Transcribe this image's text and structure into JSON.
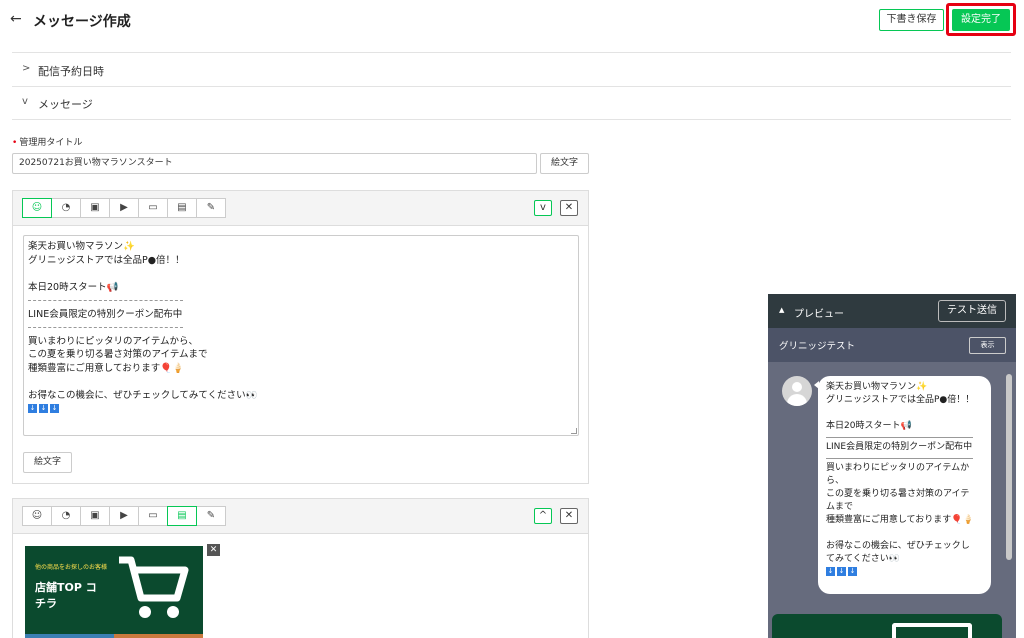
{
  "header": {
    "back_icon": "←",
    "title": "メッセージ作成",
    "draft_button": "下書き保存",
    "done_button": "設定完了",
    "accent_color": "#06c755",
    "highlight_color": "#e60012"
  },
  "sections": {
    "schedule": {
      "chevron": ">",
      "label": "配信予約日時"
    },
    "message": {
      "chevron": "v",
      "label": "メッセージ"
    }
  },
  "admin_title": {
    "label": "管理用タイトル",
    "required_mark": "•",
    "value": "20250721お買い物マラソンスタート",
    "emoji_button": "絵文字"
  },
  "message_1": {
    "toolbar": [
      "text-bubble-icon",
      "sticker-icon",
      "image-icon",
      "video-icon",
      "folder-icon",
      "list-icon",
      "pencil-icon"
    ],
    "toolbar_glyphs": [
      "☺",
      "◔",
      "▣",
      "▶",
      "▭",
      "▤",
      "✎"
    ],
    "move_down": "v",
    "close": "✕",
    "lines": [
      "楽天お買い物マラソン✨",
      "グリニッジストアでは全品P●倍！！",
      "",
      "本日20時スタート📢",
      "---",
      "LINE会員限定の特別クーポン配布中",
      "---",
      "買いまわりにピッタリのアイテムから、",
      "この夏を乗り切る暑さ対策のアイテムまで",
      "種類豊富にご用意しております🎈🍦",
      "",
      "お得なこの機会に、ぜひチェックしてみてください👀",
      "⬇⬇⬇"
    ],
    "emoji_button": "絵文字"
  },
  "message_2": {
    "toolbar_glyphs": [
      "☺",
      "◔",
      "▣",
      "▶",
      "▭",
      "▤",
      "✎"
    ],
    "move_up": "^",
    "close": "✕",
    "banner_small": "他の商品をお探しのお客様",
    "banner_big": "店舗TOP コチラ",
    "banner_close": "✕"
  },
  "preview": {
    "toggle": "▲",
    "title": "プレビュー",
    "test_button": "テスト送信",
    "account_name": "グリニッジテスト",
    "show_button": "表示",
    "bubble_lines": [
      "楽天お買い物マラソン✨",
      "グリニッジストアでは全品P●倍！！",
      "",
      "本日20時スタート📢",
      "---",
      "LINE会員限定の特別クーポン配布中",
      "---",
      "買いまわりにピッタリのアイテムか",
      "ら、",
      "この夏を乗り切る暑さ対策のアイテ",
      "ムまで",
      "種類豊富にご用意しております🎈🍦",
      "",
      "お得なこの機会に、ぜひチェックし",
      "てみてください👀",
      "⬇⬇⬇"
    ]
  }
}
